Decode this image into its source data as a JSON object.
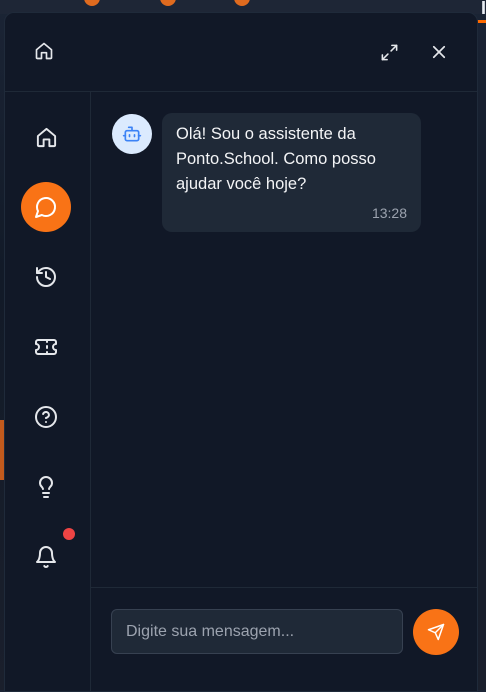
{
  "background": {
    "text": "I"
  },
  "colors": {
    "accent": "#f97316",
    "panel": "#111827",
    "bubble": "#1f2937",
    "notification": "#ef4444"
  },
  "header": {
    "home_icon": "home-icon",
    "expand_icon": "expand-icon",
    "close_icon": "close-icon"
  },
  "sidebar": {
    "items": [
      {
        "icon": "home-icon",
        "active": false
      },
      {
        "icon": "chat-icon",
        "active": true
      },
      {
        "icon": "history-icon",
        "active": false
      },
      {
        "icon": "ticket-icon",
        "active": false
      },
      {
        "icon": "help-icon",
        "active": false
      },
      {
        "icon": "lightbulb-icon",
        "active": false
      },
      {
        "icon": "bell-icon",
        "active": false,
        "badge": true
      }
    ]
  },
  "messages": [
    {
      "sender_icon": "bot-icon",
      "text": "Olá! Sou o assistente da Ponto.School. Como posso ajudar você hoje?",
      "time": "13:28"
    }
  ],
  "composer": {
    "placeholder": "Digite sua mensagem...",
    "value": "",
    "send_icon": "send-icon"
  }
}
